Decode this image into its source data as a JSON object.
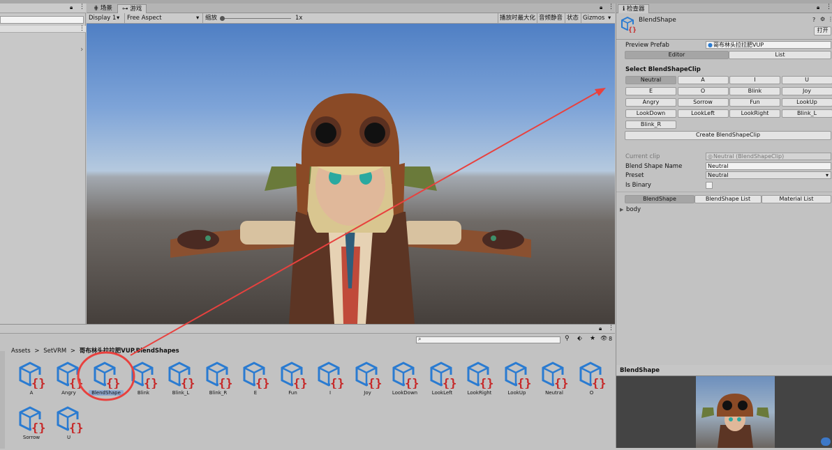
{
  "hierarchy_panel": {
    "expand_glyph": "›"
  },
  "tabs": [
    {
      "label": "场景",
      "icon": "grid-icon"
    },
    {
      "label": "游戏",
      "icon": "gamepad-icon"
    }
  ],
  "game_toolbar": {
    "display": "Display 1",
    "aspect": "Free Aspect",
    "scale_label": "缩放",
    "scale_value": "1x",
    "maximize": "播放时最大化",
    "mute": "音频静音",
    "stats": "状态",
    "gizmos": "Gizmos"
  },
  "project": {
    "breadcrumb": [
      {
        "label": "Assets",
        "bold": false
      },
      {
        "label": "SetVRM",
        "bold": false
      },
      {
        "label": "哥布林头拉拉肥VUP.BlendShapes",
        "bold": true
      }
    ],
    "breadcrumb_sep": ">",
    "item_count": "8",
    "assets": [
      {
        "label": "A",
        "selected": false
      },
      {
        "label": "Angry",
        "selected": false
      },
      {
        "label": "BlendShape",
        "selected": true
      },
      {
        "label": "Blink",
        "selected": false
      },
      {
        "label": "Blink_L",
        "selected": false
      },
      {
        "label": "Blink_R",
        "selected": false
      },
      {
        "label": "E",
        "selected": false
      },
      {
        "label": "Fun",
        "selected": false
      },
      {
        "label": "I",
        "selected": false
      },
      {
        "label": "Joy",
        "selected": false
      },
      {
        "label": "LookDown",
        "selected": false
      },
      {
        "label": "LookLeft",
        "selected": false
      },
      {
        "label": "LookRight",
        "selected": false
      },
      {
        "label": "LookUp",
        "selected": false
      },
      {
        "label": "Neutral",
        "selected": false
      },
      {
        "label": "O",
        "selected": false
      },
      {
        "label": "Sorrow",
        "selected": false
      },
      {
        "label": "U",
        "selected": false
      }
    ]
  },
  "inspector": {
    "tab_label": "检查器",
    "object_name": "BlendShape",
    "open_button": "打开",
    "preview_prefab_label": "Preview Prefab",
    "preview_prefab_value": "哥布林头拉拉肥VUP",
    "mode_tabs": [
      "Editor",
      "List"
    ],
    "select_clip_header": "Select BlendShapeClip",
    "clip_buttons": [
      "Neutral",
      "A",
      "I",
      "U",
      "E",
      "O",
      "Blink",
      "Joy",
      "Angry",
      "Sorrow",
      "Fun",
      "LookUp",
      "LookDown",
      "LookLeft",
      "LookRight",
      "Blink_L",
      "Blink_R"
    ],
    "create_button": "Create BlendShapeClip",
    "current_clip_label": "Current clip",
    "current_clip_value": "Neutral (BlendShapeClip)",
    "blend_shape_name_label": "Blend Shape Name",
    "blend_shape_name_value": "Neutral",
    "preset_label": "Preset",
    "preset_value": "Neutral",
    "is_binary_label": "Is Binary",
    "is_binary_checked": false,
    "sub_tabs": [
      "BlendShape",
      "BlendShape List",
      "Material List"
    ],
    "body_label": "body"
  },
  "preview": {
    "title": "BlendShape"
  },
  "colors": {
    "accent_red": "#e8413e",
    "asset_blue": "#2a7bd1",
    "asset_red": "#c62828",
    "selected_bg": "#8fa9cf"
  }
}
